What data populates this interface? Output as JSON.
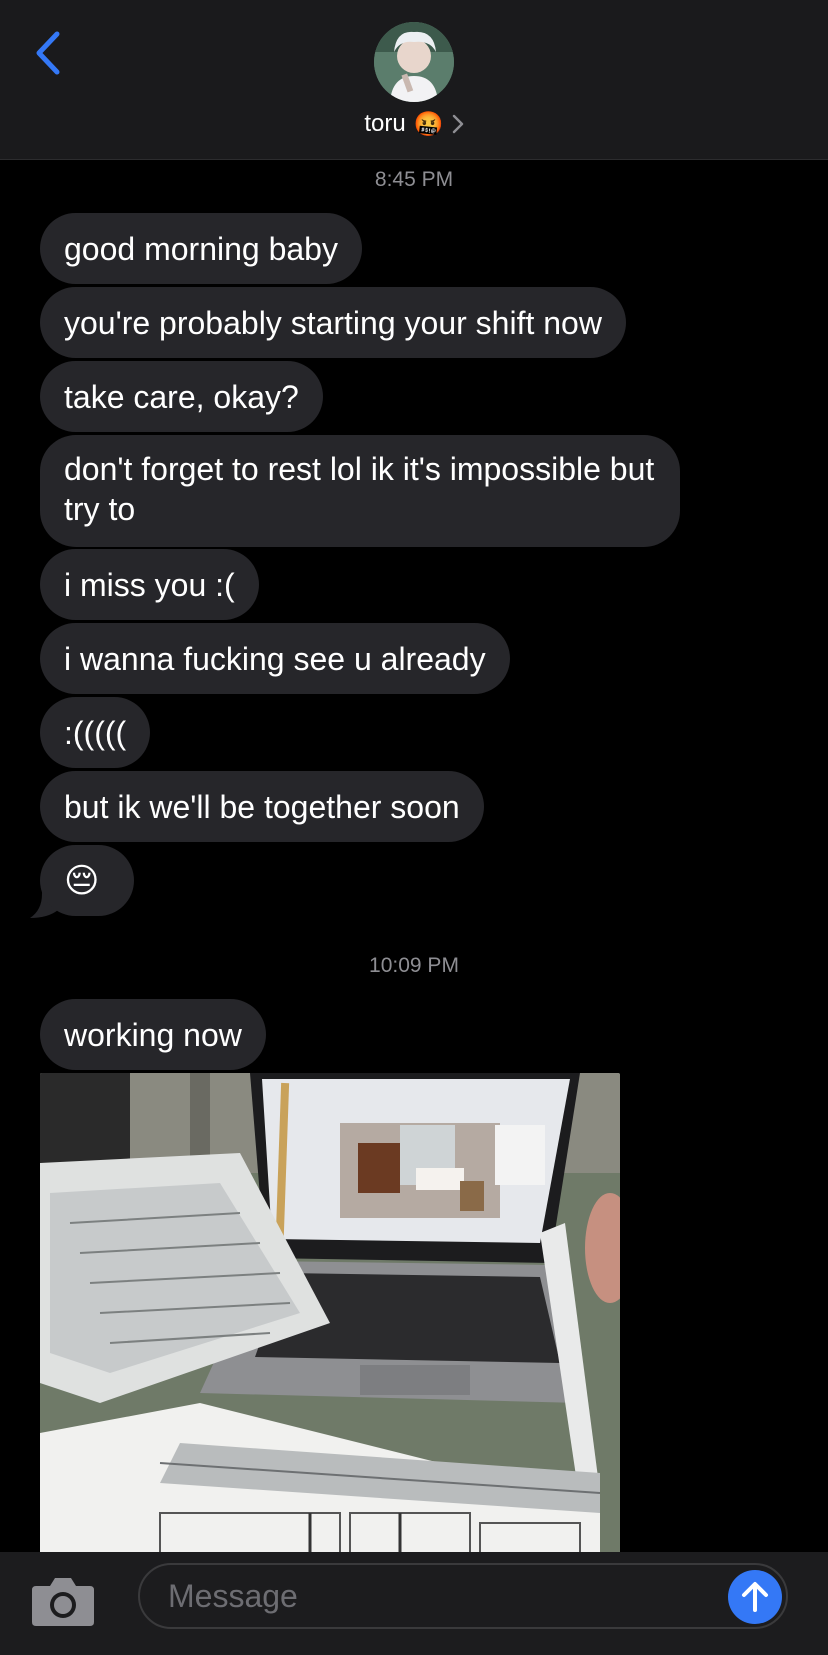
{
  "header": {
    "contact_name": "toru",
    "contact_emoji": "🤬",
    "icons": {
      "back": "chevron-left-icon",
      "details": "chevron-right-icon"
    },
    "accent": "#3478f6"
  },
  "thread": {
    "groups": [
      {
        "timestamp": "8:45 PM",
        "messages": [
          "good morning baby",
          "you're probably starting your shift now",
          "take care, okay?",
          "don't forget to rest lol ik it's impossible but try to",
          "i miss you :(",
          "i wanna fucking see u already",
          ":(((((",
          "but ik we'll be together soon",
          "😔"
        ]
      },
      {
        "timestamp": "10:09 PM",
        "messages": [
          "working now"
        ],
        "attachment": "photo"
      }
    ]
  },
  "composer": {
    "placeholder": "Message",
    "icons": {
      "camera": "camera-icon",
      "send": "arrow-up-icon"
    }
  }
}
